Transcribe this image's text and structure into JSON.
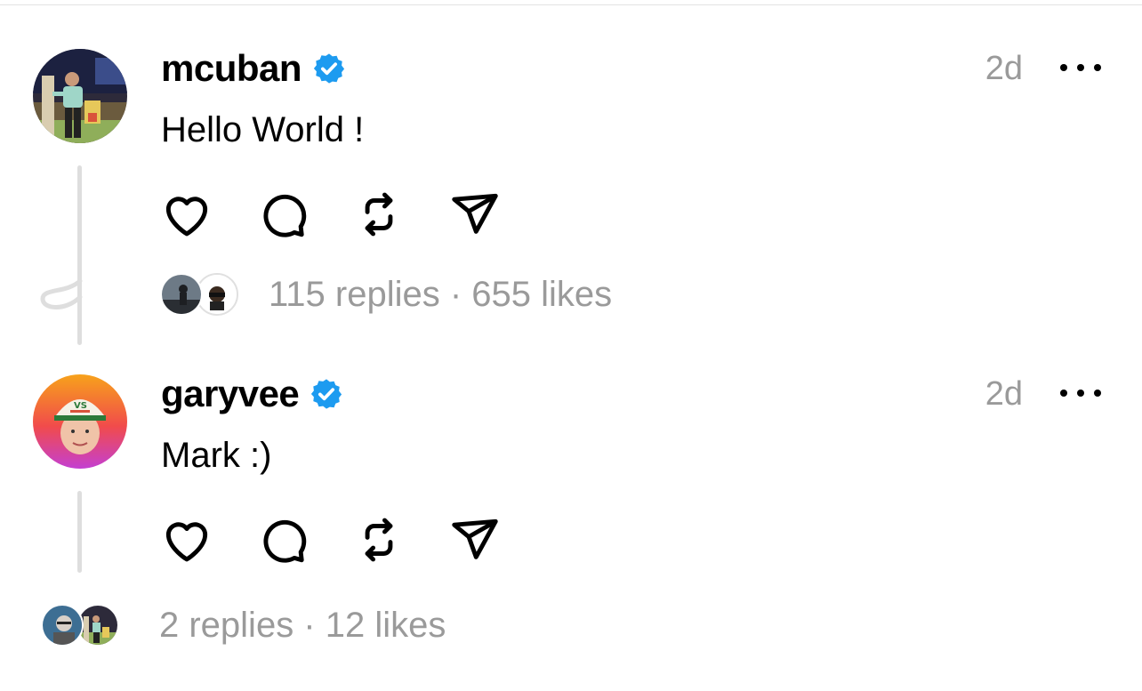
{
  "posts": [
    {
      "username": "mcuban",
      "time": "2d",
      "text": "Hello World !",
      "stats": "115 replies · 655 likes",
      "icons": [
        "heart-icon",
        "comment-icon",
        "repost-icon",
        "share-icon",
        "verified-icon",
        "more-icon"
      ]
    },
    {
      "username": "garyvee",
      "time": "2d",
      "text": "Mark :)",
      "stats": "2 replies · 12 likes",
      "icons": [
        "heart-icon",
        "comment-icon",
        "repost-icon",
        "share-icon",
        "verified-icon",
        "more-icon"
      ]
    }
  ],
  "colors": {
    "verified": "#1d9bf0",
    "muted_text": "#9a9a9a",
    "thread_line": "#dedede"
  }
}
